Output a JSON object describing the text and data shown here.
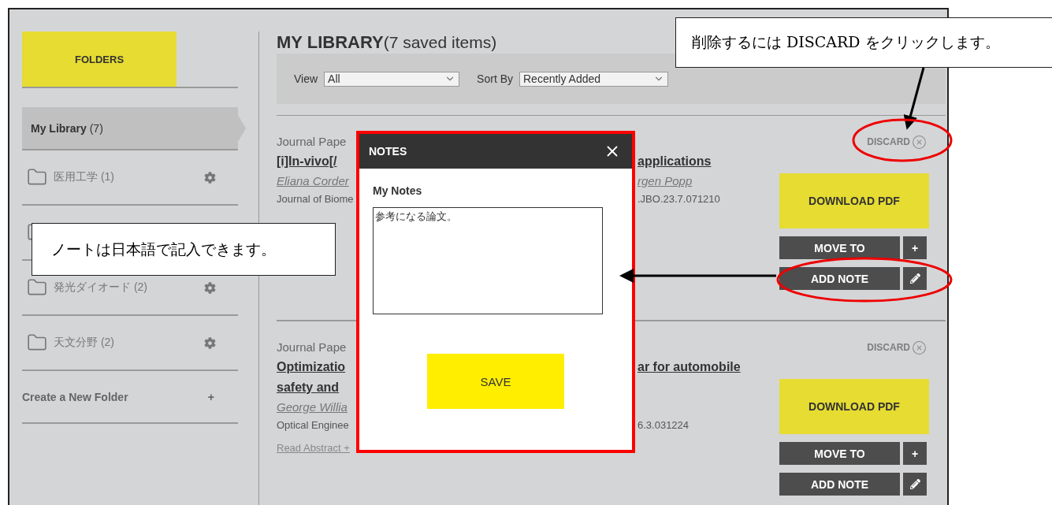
{
  "sidebar": {
    "header": "FOLDERS",
    "items": [
      {
        "kind": "library",
        "label": "**My Library** (7)",
        "selected": true
      },
      {
        "kind": "folder",
        "label": "医用工学 (1)",
        "selected": false
      },
      {
        "kind": "folder",
        "selected": false
      },
      {
        "kind": "folder",
        "label": "発光ダイオード (2)",
        "selected": false
      },
      {
        "kind": "folder",
        "label": "天文分野 (2)",
        "selected": false
      }
    ],
    "create": {
      "label": "Create a New Folder",
      "icon": "+"
    }
  },
  "library": {
    "title": "MY LIBRARY",
    "subtitle": "(7 saved items)",
    "view": {
      "label": "View",
      "value": "All"
    },
    "sort": {
      "label": "Sort By",
      "value": "Recently Added"
    }
  },
  "items": [
    {
      "type": "Journal Pape",
      "title_lines": [
        {
          "start": "[i]In-vivo[/",
          "end": "applications"
        }
      ],
      "authors": {
        "start": "Eliana Corder",
        "end": "rgen Popp"
      },
      "journal": {
        "start": "Journal of Biome",
        "end": ".JBO.23.7.071210"
      },
      "discard": "DISCARD",
      "download": "DOWNLOAD PDF",
      "move": "MOVE TO",
      "move_icon": "+",
      "add_note": "ADD NOTE"
    },
    {
      "type": "Journal Pape",
      "title_lines": [
        {
          "start": "Optimizatio",
          "end": "ar for automobile"
        },
        {
          "start": "safety and"
        }
      ],
      "authors": {
        "start": "George Willia"
      },
      "journal": {
        "start": "Optical Enginee",
        "end": "6.3.031224"
      },
      "read_abstract": "Read Abstract +",
      "discard": "DISCARD",
      "download": "DOWNLOAD PDF",
      "move": "MOVE TO",
      "move_icon": "+",
      "add_note": "ADD NOTE"
    }
  ],
  "modal": {
    "title": "NOTES",
    "label": "My Notes",
    "value": "参考になる論文。",
    "button": "SAVE"
  },
  "callouts": [
    {
      "text": "削除するには DISCARD をクリックします。"
    },
    {
      "text": "ノートは日本語で記入できます。"
    }
  ]
}
